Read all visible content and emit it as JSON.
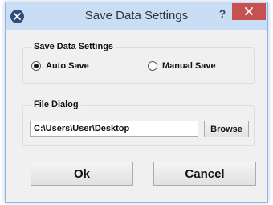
{
  "window": {
    "title": "Save Data Settings",
    "help_label": "?",
    "accent_color": "#c9def5",
    "close_color": "#c75050"
  },
  "save_group": {
    "label": "Save Data Settings",
    "options": [
      {
        "label": "Auto Save",
        "selected": true
      },
      {
        "label": "Manual Save",
        "selected": false
      }
    ]
  },
  "file_group": {
    "label": "File Dialog",
    "path_value": "C:\\Users\\User\\Desktop",
    "browse_label": "Browse"
  },
  "buttons": {
    "ok_label": "Ok",
    "cancel_label": "Cancel"
  }
}
